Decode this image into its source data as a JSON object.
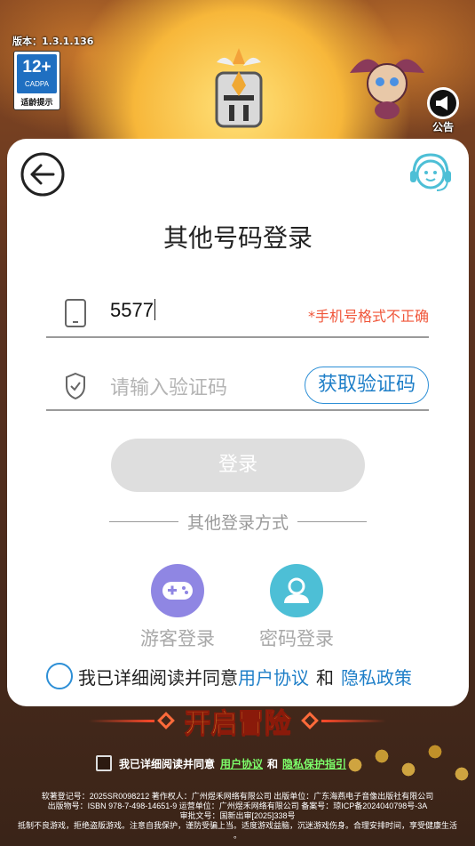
{
  "app": {
    "version": "版本：1.3.1.136",
    "age_rating": {
      "number": "12+",
      "org": "CADPA",
      "tip": "适龄提示"
    },
    "notice_label": "公告"
  },
  "login": {
    "title": "其他号码登录",
    "phone": {
      "value": "5577",
      "error": "*手机号格式不正确"
    },
    "code": {
      "placeholder": "请输入验证码",
      "get_code_label": "获取验证码"
    },
    "login_button": "登录",
    "other_methods_label": "其他登录方式",
    "alt_methods": [
      {
        "label": "游客登录",
        "icon": "gamepad-icon"
      },
      {
        "label": "密码登录",
        "icon": "user-icon"
      }
    ],
    "agreement": {
      "prefix": "我已详细阅读并同意",
      "user_agreement": "用户协议",
      "and": "和",
      "privacy_policy": "隐私政策"
    }
  },
  "background": {
    "banner_text": "开启冒险",
    "agreement": {
      "prefix": "我已详细阅读并同意",
      "user_agreement": "用户协议",
      "and": "和",
      "privacy_link": "隐私保护指引"
    },
    "legal_lines": [
      "软著登记号：2025SR0098212 著作权人：广州煜禾网络有限公司 出版单位：广东海燕电子音像出版社有限公司",
      "出版物号：ISBN 978-7-498-14651-9 运营单位：广州煜禾网络有限公司 备案号：琼ICP备2024040798号-3A",
      "审批文号：国新出审[2025]338号",
      "抵制不良游戏，拒绝盗版游戏。注意自我保护，谨防受骗上当。适度游戏益脑，沉迷游戏伤身。合理安排时间，享受健康生活",
      "。"
    ]
  },
  "colors": {
    "accent": "#1f7fc8",
    "error": "#f0563a",
    "guest_circle": "#8f86e3",
    "password_circle": "#4dbfd6",
    "disabled_button": "#dedede"
  }
}
